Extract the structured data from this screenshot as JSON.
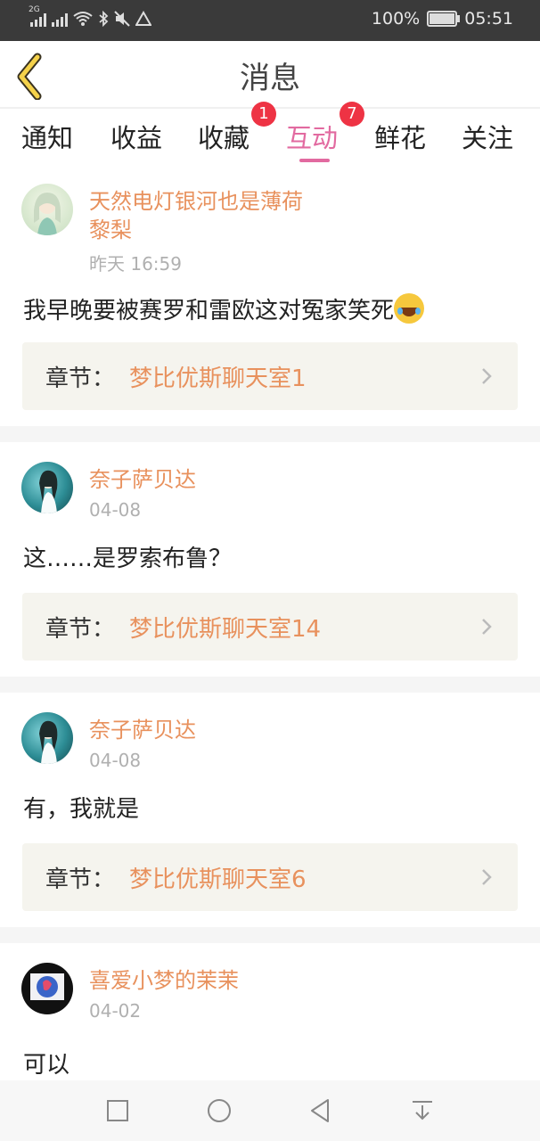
{
  "status_bar": {
    "battery": "100%",
    "time": "05:51",
    "signal_tag": "2G"
  },
  "header": {
    "title": "消息"
  },
  "tabs": [
    {
      "label": "通知",
      "badge": ""
    },
    {
      "label": "收益",
      "badge": ""
    },
    {
      "label": "收藏",
      "badge": "1"
    },
    {
      "label": "互动",
      "badge": "7",
      "active": true
    },
    {
      "label": "鲜花",
      "badge": ""
    },
    {
      "label": "关注",
      "badge": ""
    }
  ],
  "chapter_prefix": "章节：",
  "items": [
    {
      "name_line1": "天然电灯银河也是薄荷",
      "name_line2": "黎梨",
      "time": "昨天 16:59",
      "comment": "我早晚要被赛罗和雷欧这对冤家笑死",
      "comment_emoji": "face-with-tears-of-joy",
      "chapter": "梦比优斯聊天室1"
    },
    {
      "name_line1": "奈子萨贝达",
      "time": "04-08",
      "comment": "这……是罗索布鲁？",
      "chapter": "梦比优斯聊天室14"
    },
    {
      "name_line1": "奈子萨贝达",
      "time": "04-08",
      "comment": "有，我就是",
      "chapter": "梦比优斯聊天室6"
    },
    {
      "name_line1": "喜爱小梦的茉茉",
      "time": "04-02",
      "comment": "可以"
    }
  ],
  "colors": {
    "accent_pink": "#e26aa0",
    "name_orange": "#e8915d",
    "badge_red": "#ee3344"
  },
  "nav": {
    "icons": [
      "square-icon",
      "circle-home-icon",
      "triangle-back-icon",
      "notification-pull-icon"
    ]
  }
}
